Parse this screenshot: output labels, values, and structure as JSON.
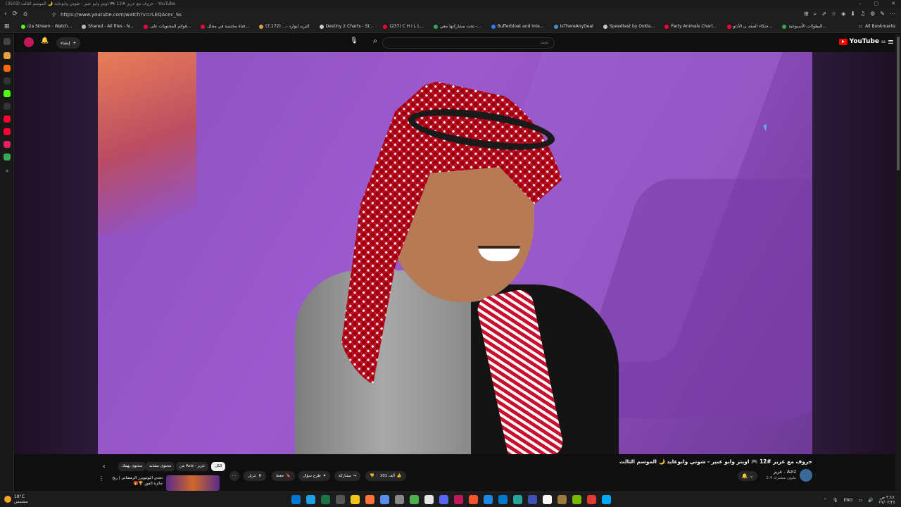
{
  "window": {
    "title": "(3503) حروف مع عزيز #12 🎮 اوبتز وابو عبير - شوتي وابوعايد 🌙 الموسم الثالث - YouTube",
    "controls": [
      "–",
      "▢",
      "✕"
    ]
  },
  "address_bar": {
    "url": "https://www.youtube.com/watch?v=rLEQAcec_Ss",
    "nav": [
      "‹",
      "⟳",
      "⌂"
    ],
    "tools": [
      "⊞",
      "⌕",
      "⇗",
      "☆",
      "◈",
      "⬇",
      "♫",
      "⚙",
      "✎",
      "⋯"
    ]
  },
  "bookmarks": {
    "items": [
      {
        "label": "i2a Stream - Watch...",
        "color": "#53fc18"
      },
      {
        "label": "Shared - All files - N...",
        "color": "#bbbbbb"
      },
      {
        "label": "قوائم المحتويات على...",
        "color": "#ff0033"
      },
      {
        "label": "قناة مختصة في مجال...",
        "color": "#ff0033"
      },
      {
        "label": "التريد ايوارد -... (7,172)",
        "color": "#d9a441"
      },
      {
        "label": "Destiny 2 Charts - St...",
        "color": "#cccccc"
      },
      {
        "label": "(237) C H I L L...",
        "color": "#ff0033"
      },
      {
        "label": "تحت مشاركتها معي -...",
        "color": "#34a853"
      },
      {
        "label": "Bufferbloat and Inte...",
        "color": "#2e7cf6"
      },
      {
        "label": "IsThereAnyDeal",
        "color": "#3d8fd6"
      },
      {
        "label": "Speedtest by Ookla...",
        "color": "#cccccc"
      },
      {
        "label": "Party Animals Chart...",
        "color": "#ff0033"
      },
      {
        "label": "حتكاء المجد ن الأدثو...",
        "color": "#ff0033"
      },
      {
        "label": "البطولات الأسبوعية...",
        "color": "#34a853"
      }
    ],
    "all_bookmarks": "All Bookmarks"
  },
  "youtube": {
    "logo_text": "YouTube",
    "logo_sup": "SA",
    "search_placeholder": "بحث",
    "create_label": "إنشاء"
  },
  "video": {
    "title": "حروف مع عزيز #12 🎮 اوبتز وابو عبير - شوتي وابوعايد 🌙 الموسم الثالث",
    "channel_name": "عزيز - Aziz",
    "channel_subs": "2.4 مليون مشترك",
    "like_count": "101 ألف",
    "share_label": "مشاركة",
    "ask_label": "طرح سؤال",
    "save_label": "حفظ",
    "download_label": "تنزيل",
    "more_label": "⋯"
  },
  "chips": {
    "all": "الكل",
    "from_channel": "من Aziz - عزيز",
    "similar": "محتوى مشابه",
    "might_like": "محتوى يهمك"
  },
  "recommendation": {
    "title": "تحدي اليوتيوبرز الرمضاني | ربح جائزة الفوز 🏆🎁",
    "more": "⋮"
  },
  "taskbar": {
    "temperature": "18°C",
    "condition": "مشمس",
    "language": "ENG",
    "time": "٣:٤٨ ص",
    "date": "٢٧/٠٣/٢٤",
    "app_colors": [
      "#0078d4",
      "#1ba1e2",
      "#1e7145",
      "#555555",
      "#f0c419",
      "#ff7139",
      "#5b8def",
      "#888888",
      "#4caf50",
      "#e6e6e6",
      "#5865f2",
      "#c2185b",
      "#fb542b",
      "#1e88e5",
      "#007acc",
      "#26a69a",
      "#3f51b5",
      "#f8f8f8",
      "#9c7a3c",
      "#76b900",
      "#e53935",
      "#03a9f4"
    ]
  }
}
